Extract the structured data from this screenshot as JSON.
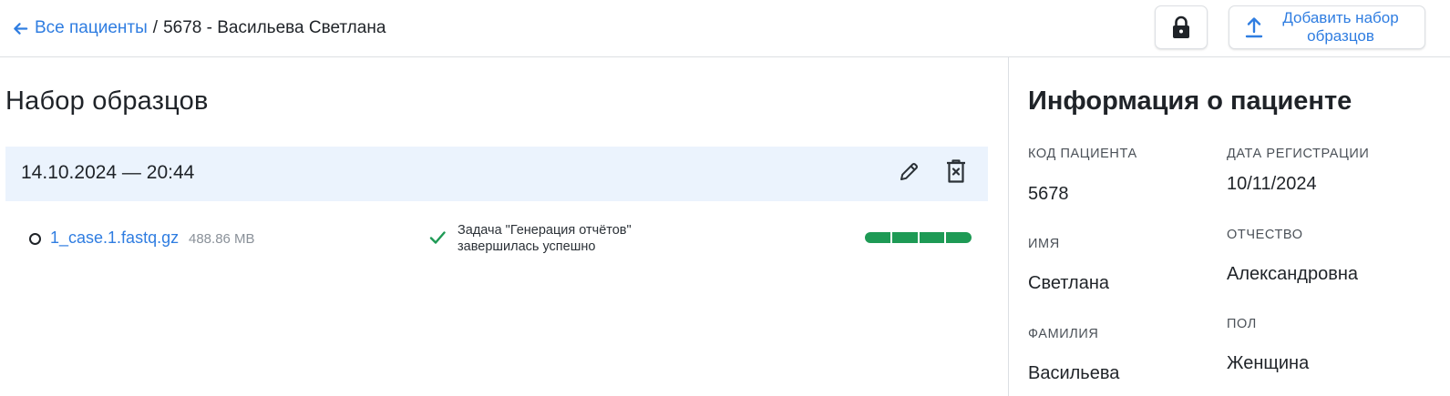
{
  "breadcrumb": {
    "back_label": "Все пациенты",
    "separator": "/",
    "current": "5678 - Васильева Светлана"
  },
  "toolbar": {
    "upload_label": "Добавить набор\nобразцов"
  },
  "samples": {
    "title": "Набор образцов",
    "set": {
      "date": "14.10.2024 — 20:44",
      "files": [
        {
          "name": "1_case.1.fastq.gz",
          "size": "488.86 MB",
          "status_line1": "Задача \"Генерация отчётов\"",
          "status_line2": "завершилась успешно",
          "progress_steps_done": 4,
          "progress_steps_total": 4
        }
      ]
    }
  },
  "patient": {
    "title": "Информация о пациенте",
    "fields": {
      "code": {
        "label": "КОД ПАЦИЕНТА",
        "value": "5678"
      },
      "reg_date": {
        "label": "ДАТА РЕГИСТРАЦИИ",
        "value": "10/11/2024"
      },
      "first_name": {
        "label": "ИМЯ",
        "value": "Светлана"
      },
      "patronymic": {
        "label": "ОТЧЕСТВО",
        "value": "Александровна"
      },
      "last_name": {
        "label": "ФАМИЛИЯ",
        "value": "Васильева"
      },
      "sex": {
        "label": "ПОЛ",
        "value": "Женщина"
      }
    }
  },
  "colors": {
    "accent": "#2f7de1",
    "success": "#1e9a55",
    "set_header_bg": "#ebf3fd"
  },
  "icons": [
    "arrow-left-icon",
    "lock-icon",
    "upload-icon",
    "pencil-icon",
    "trash-icon",
    "check-icon"
  ]
}
